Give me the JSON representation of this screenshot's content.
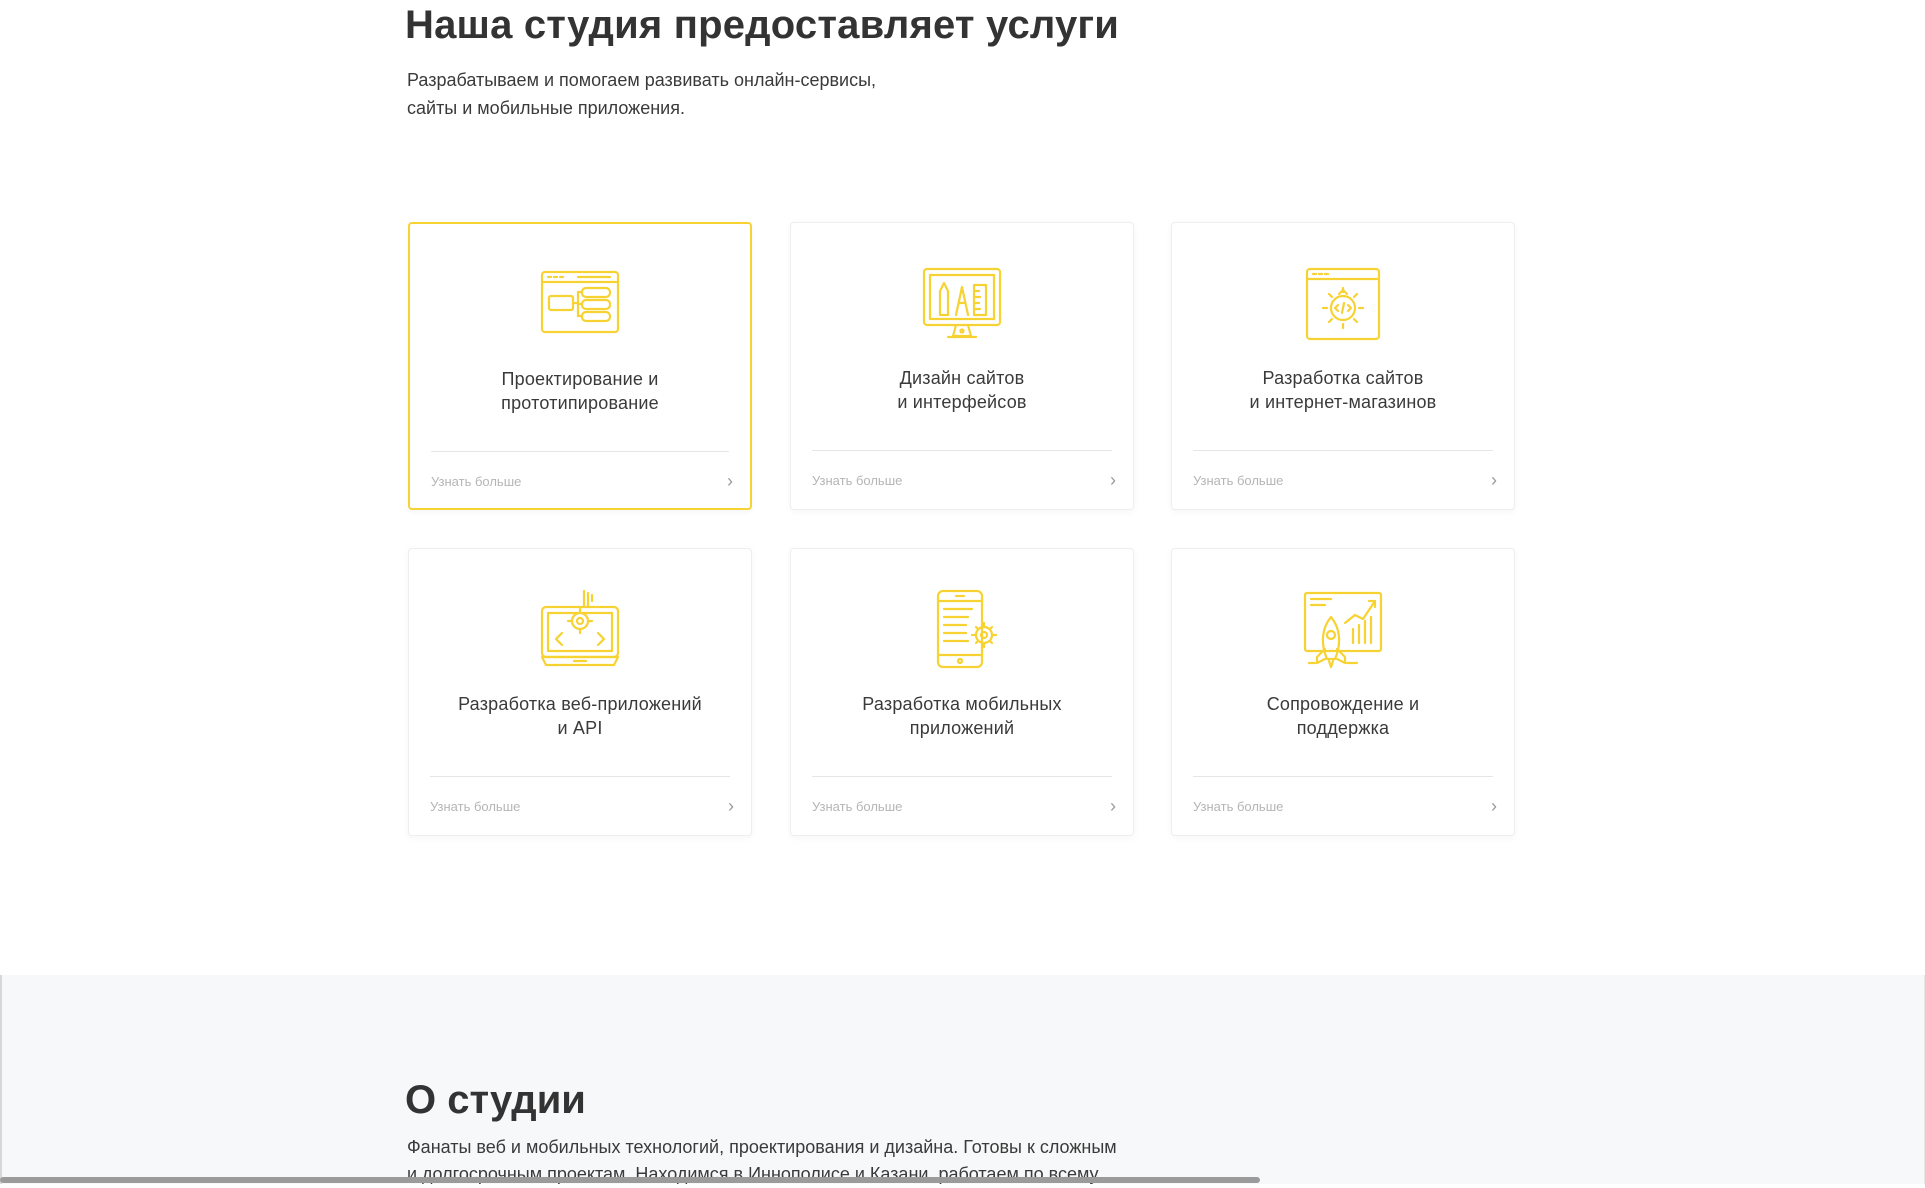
{
  "services": {
    "title": "Наша студия предоставляет услуги",
    "subtitle_line1": "Разрабатываем и помогаем развивать онлайн-сервисы,",
    "subtitle_line2": "сайты и мобильные приложения.",
    "accent_color": "#f7d233",
    "cards": [
      {
        "title1": "Проектирование и",
        "title2": "прототипирование",
        "more": "Узнать больше",
        "icon": "prototype-window-icon"
      },
      {
        "title1": "Дизайн сайтов",
        "title2": "и интерфейсов",
        "more": "Узнать больше",
        "icon": "design-monitor-icon"
      },
      {
        "title1": "Разработка сайтов",
        "title2": "и интернет-магазинов",
        "more": "Узнать больше",
        "icon": "code-gear-window-icon"
      },
      {
        "title1": "Разработка веб-приложений",
        "title2": "и API",
        "more": "Узнать больше",
        "icon": "web-app-laptop-icon"
      },
      {
        "title1": "Разработка мобильных",
        "title2": "приложений",
        "more": "Узнать больше",
        "icon": "mobile-gear-icon"
      },
      {
        "title1": "Сопровождение и",
        "title2": "поддержка",
        "more": "Узнать больше",
        "icon": "rocket-chart-icon"
      }
    ]
  },
  "about": {
    "title": "О студии",
    "line1": "Фанаты веб и мобильных технологий, проектирования и дизайна. Готовы к сложным",
    "line2": "и долгосрочным проектам. Находимся в Иннополисе и Казани, работаем по всему"
  }
}
